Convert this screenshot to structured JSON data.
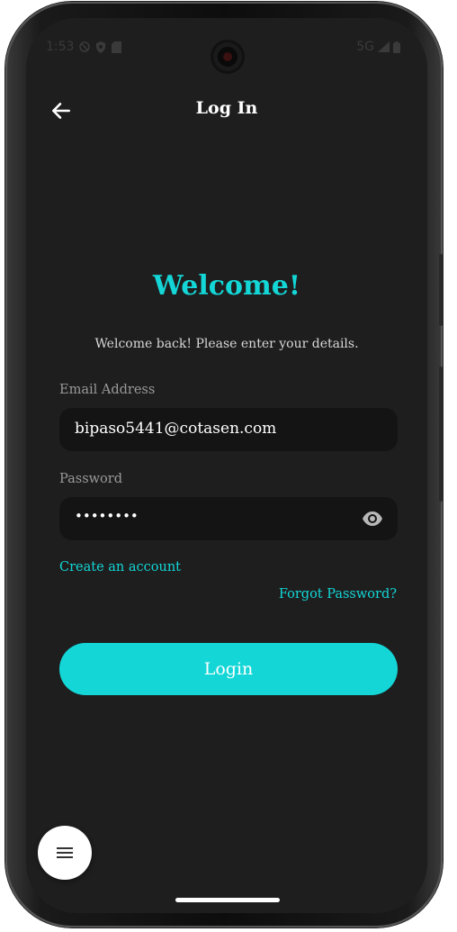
{
  "status_bar": {
    "time": "1:53",
    "network": "5G"
  },
  "header": {
    "title": "Log In"
  },
  "welcome": {
    "title": "Welcome!",
    "subtitle": "Welcome back! Please enter your details."
  },
  "form": {
    "email_label": "Email Address",
    "email_value": "bipaso5441@cotasen.com",
    "password_label": "Password",
    "password_value": "••••••••"
  },
  "links": {
    "create_account": "Create an account",
    "forgot_password": "Forgot Password?"
  },
  "login_button": {
    "label": "Login"
  },
  "icons": {
    "back": "arrow-left-icon",
    "eye": "eye-icon",
    "menu": "hamburger-menu-icon"
  },
  "colors": {
    "accent": "#14d6d6",
    "background": "#1e1e1f",
    "field": "#141415",
    "text": "#ffffff"
  }
}
